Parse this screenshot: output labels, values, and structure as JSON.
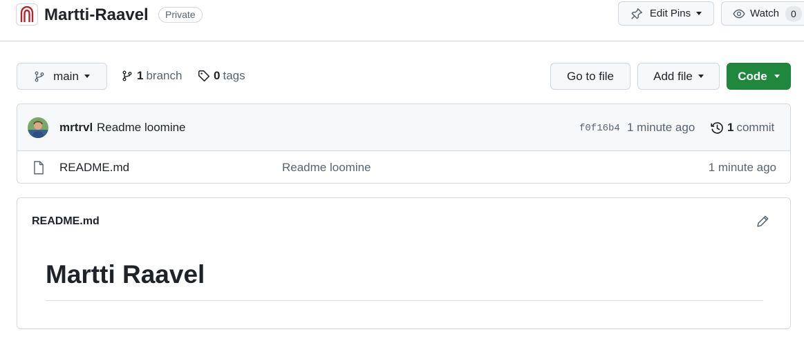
{
  "repo": {
    "name": "Martti-Raavel",
    "visibility": "Private"
  },
  "header_actions": {
    "edit_pins": "Edit Pins",
    "watch": "Watch",
    "watch_count": "0"
  },
  "toolbar": {
    "branch": "main",
    "branch_count": "1",
    "branch_label": "branch",
    "tag_count": "0",
    "tag_label": "tags",
    "goto_file": "Go to file",
    "add_file": "Add file",
    "code": "Code"
  },
  "latest_commit": {
    "author": "mrtrvl",
    "message": "Readme loomine",
    "sha": "f0f16b4",
    "time": "1 minute ago",
    "commit_count": "1",
    "commit_label": "commit"
  },
  "files": [
    {
      "name": "README.md",
      "message": "Readme loomine",
      "time": "1 minute ago"
    }
  ],
  "readme": {
    "filename": "README.md",
    "heading": "Martti Raavel"
  },
  "colors": {
    "accent_green": "#1f883d",
    "border": "#d0d7de",
    "muted_text": "#59636e",
    "repo_icon": "#b3262d"
  }
}
